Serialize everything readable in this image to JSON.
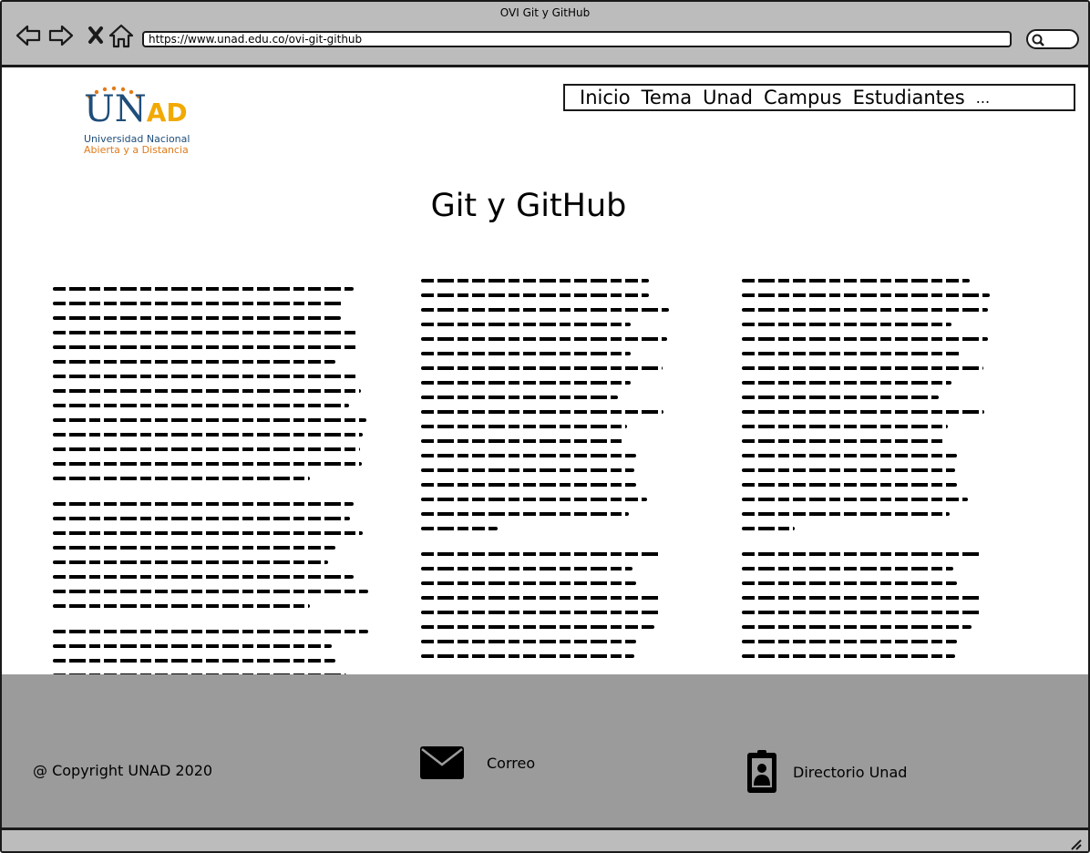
{
  "window": {
    "title": "OVI Git y GitHub"
  },
  "browser": {
    "url": "https://www.unad.edu.co/ovi-git-github",
    "back_icon": "arrow-left-icon",
    "forward_icon": "arrow-right-icon",
    "stop_icon": "close-icon",
    "home_icon": "home-icon",
    "search_icon": "search-icon"
  },
  "logo": {
    "brand": "UNAD",
    "line1": "Universidad Nacional",
    "line2": "Abierta y a  Distancia",
    "colors": {
      "blue": "#1f4e7a",
      "yellow": "#f2a900",
      "orange": "#e07b1a"
    }
  },
  "menu": {
    "items": [
      "Inicio",
      "Tema",
      "Unad",
      "Campus",
      "Estudiantes",
      "..."
    ]
  },
  "page": {
    "title": "Git y GitHub"
  },
  "footer": {
    "copyright": "@ Copyright UNAD 2020",
    "mail_label": "Correo",
    "mail_icon": "envelope-icon",
    "directory_label": "Directorio Unad",
    "directory_icon": "contact-card-icon",
    "background": "#9b9b9b"
  }
}
